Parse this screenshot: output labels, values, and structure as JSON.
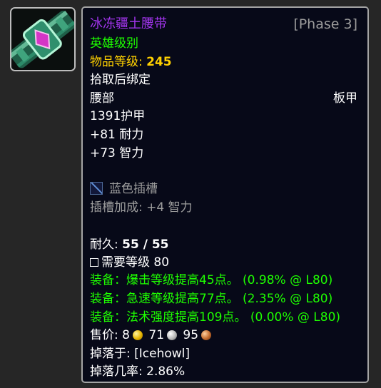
{
  "item": {
    "name": "冰冻疆土腰带",
    "phase": "[Phase 3]",
    "quality": "英雄级别",
    "item_level_label": "物品等级:",
    "item_level_value": "245",
    "binding": "拾取后绑定",
    "slot": "腰部",
    "armor_type": "板甲",
    "armor": "1391护甲",
    "stats": [
      "+81 耐力",
      "+73 智力"
    ],
    "socket_label": "蓝色插槽",
    "socket_bonus": "插槽加成: +4 智力",
    "durability_label": "耐久:",
    "durability_value": "55 / 55",
    "required_level": "需要等级 80",
    "equip_effects": [
      {
        "text": "装备：爆击等级提高45点。",
        "percent": "(0.98% @ L80)"
      },
      {
        "text": "装备：急速等级提高77点。",
        "percent": "(2.35% @ L80)"
      },
      {
        "text": "装备：法术强度提高109点。",
        "percent": "(0.00% @ L80)"
      }
    ],
    "sell_label": "售价:",
    "sell_gold": "8",
    "sell_silver": "71",
    "sell_copper": "95",
    "drop_from_label": "掉落于:",
    "drop_from_value": "[Icehowl]",
    "drop_rate_label": "掉落几率:",
    "drop_rate_value": "2.86%"
  },
  "colors": {
    "epic": "#a335ee",
    "uncommon": "#1eff00",
    "item_level": "#ffd100",
    "grey": "#9d9d9d",
    "background": "#070918"
  },
  "icons": {
    "item": "plate-belt-icon",
    "socket": "blue-socket-icon",
    "gold": "gold-coin-icon",
    "silver": "silver-coin-icon",
    "copper": "copper-coin-icon"
  }
}
